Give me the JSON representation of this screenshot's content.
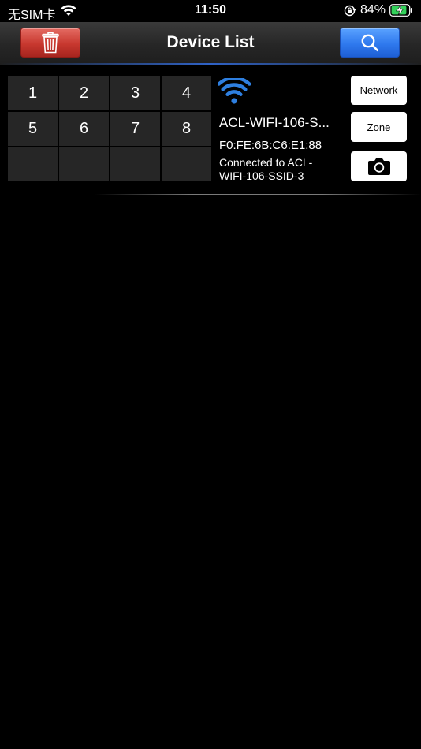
{
  "status_bar": {
    "carrier": "无SIM卡",
    "time": "11:50",
    "battery_percent": "84%",
    "icons": [
      "wifi-icon",
      "orientation-lock-icon",
      "battery-charging-icon"
    ]
  },
  "nav_bar": {
    "title": "Device List",
    "left_button_icon": "trash-icon",
    "right_button_icon": "search-icon",
    "left_button_color": "#c8382f",
    "right_button_color": "#2f79ee"
  },
  "devices": [
    {
      "zones": [
        "1",
        "2",
        "3",
        "4",
        "5",
        "6",
        "7",
        "8",
        "",
        "",
        "",
        ""
      ],
      "signal_icon": "wifi-signal-icon",
      "signal_color": "#2e7fe0",
      "name": "ACL-WIFI-106-S...",
      "mac": "F0:FE:6B:C6:E1:88",
      "status": "Connected to ACL-WIFI-106-SSID-3",
      "network_label": "Network",
      "zone_label": "Zone",
      "camera_icon": "camera-icon"
    }
  ]
}
